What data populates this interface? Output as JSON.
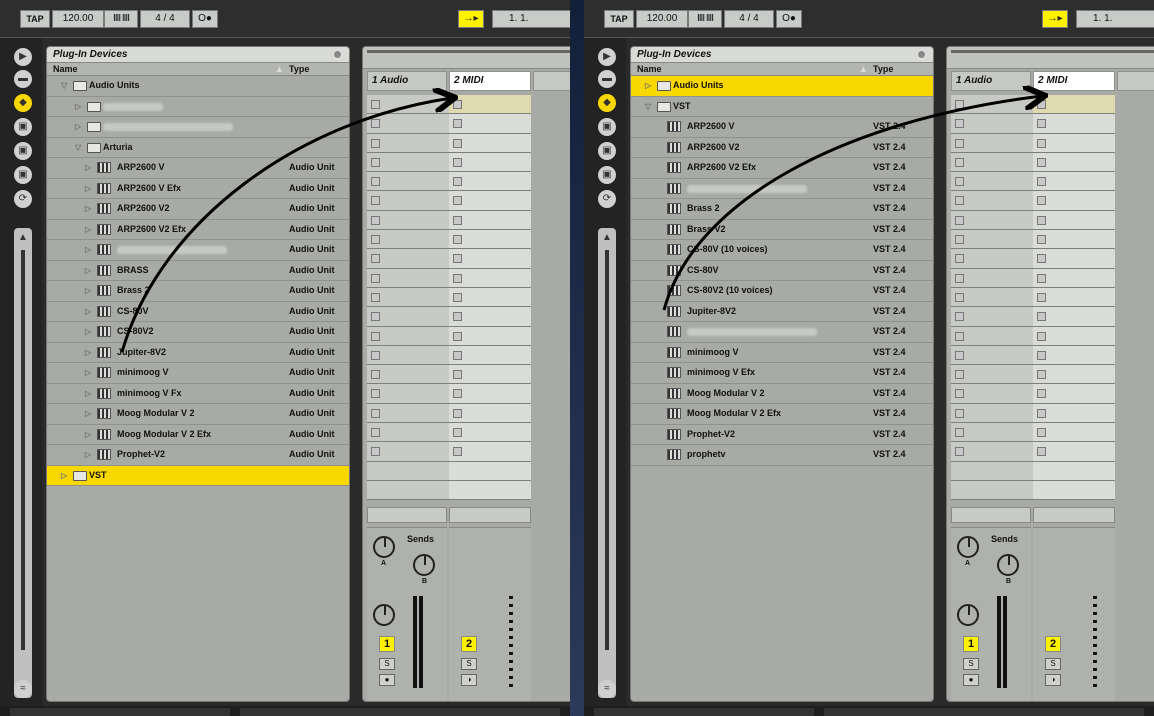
{
  "transport": {
    "tap": "TAP",
    "bpm": "120.00",
    "bars": "IIII IIII",
    "sig": "4 / 4",
    "metro": "O●",
    "follow": "→▸",
    "pos": "1.   1."
  },
  "browser": {
    "title": "Plug-In Devices",
    "col_name": "Name",
    "col_type": "Type"
  },
  "tracks": {
    "t1": "1 Audio",
    "t2": "2 MIDI"
  },
  "mixer": {
    "sends": "Sends",
    "send_a": "A",
    "send_b": "B",
    "num1": "1",
    "num2": "2",
    "solo": "S"
  },
  "left_rows": [
    {
      "label": "Audio Units",
      "type": "",
      "indent": 0,
      "icon": "folder",
      "open": true,
      "sel": false
    },
    {
      "label": "",
      "type": "",
      "indent": 1,
      "icon": "folder",
      "open": false,
      "blur": 60
    },
    {
      "label": "",
      "type": "",
      "indent": 1,
      "icon": "folder",
      "open": false,
      "blur": 130
    },
    {
      "label": "Arturia",
      "type": "",
      "indent": 1,
      "icon": "folder",
      "open": true
    },
    {
      "label": "ARP2600 V",
      "type": "Audio Unit",
      "indent": 2,
      "icon": "plugin"
    },
    {
      "label": "ARP2600 V Efx",
      "type": "Audio Unit",
      "indent": 2,
      "icon": "plugin"
    },
    {
      "label": "ARP2600 V2",
      "type": "Audio Unit",
      "indent": 2,
      "icon": "plugin"
    },
    {
      "label": "ARP2600 V2 Efx",
      "type": "Audio Unit",
      "indent": 2,
      "icon": "plugin"
    },
    {
      "label": "",
      "type": "Audio Unit",
      "indent": 2,
      "icon": "plugin",
      "blur": 110
    },
    {
      "label": "BRASS",
      "type": "Audio Unit",
      "indent": 2,
      "icon": "plugin"
    },
    {
      "label": "Brass 2",
      "type": "Audio Unit",
      "indent": 2,
      "icon": "plugin"
    },
    {
      "label": "CS-80V",
      "type": "Audio Unit",
      "indent": 2,
      "icon": "plugin"
    },
    {
      "label": "CS-80V2",
      "type": "Audio Unit",
      "indent": 2,
      "icon": "plugin"
    },
    {
      "label": "Jupiter-8V2",
      "type": "Audio Unit",
      "indent": 2,
      "icon": "plugin"
    },
    {
      "label": "minimoog V",
      "type": "Audio Unit",
      "indent": 2,
      "icon": "plugin"
    },
    {
      "label": "minimoog V Fx",
      "type": "Audio Unit",
      "indent": 2,
      "icon": "plugin"
    },
    {
      "label": "Moog Modular V 2",
      "type": "Audio Unit",
      "indent": 2,
      "icon": "plugin"
    },
    {
      "label": "Moog Modular V 2 Efx",
      "type": "Audio Unit",
      "indent": 2,
      "icon": "plugin"
    },
    {
      "label": "Prophet-V2",
      "type": "Audio Unit",
      "indent": 2,
      "icon": "plugin"
    },
    {
      "label": "VST",
      "type": "",
      "indent": 0,
      "icon": "folder",
      "open": false,
      "sel": true
    }
  ],
  "right_rows": [
    {
      "label": "Audio Units",
      "type": "",
      "indent": 0,
      "icon": "folder",
      "open": false,
      "sel": true
    },
    {
      "label": "VST",
      "type": "",
      "indent": 0,
      "icon": "folder",
      "open": true
    },
    {
      "label": "ARP2600 V",
      "type": "VST 2.4",
      "indent": 1,
      "icon": "plugin"
    },
    {
      "label": "ARP2600 V2",
      "type": "VST 2.4",
      "indent": 1,
      "icon": "plugin"
    },
    {
      "label": "ARP2600 V2 Efx",
      "type": "VST 2.4",
      "indent": 1,
      "icon": "plugin"
    },
    {
      "label": "",
      "type": "VST 2.4",
      "indent": 1,
      "icon": "plugin",
      "blur": 120
    },
    {
      "label": "Brass 2",
      "type": "VST 2.4",
      "indent": 1,
      "icon": "plugin"
    },
    {
      "label": "Brass V2",
      "type": "VST 2.4",
      "indent": 1,
      "icon": "plugin"
    },
    {
      "label": "CS-80V (10 voices)",
      "type": "VST 2.4",
      "indent": 1,
      "icon": "plugin"
    },
    {
      "label": "CS-80V",
      "type": "VST 2.4",
      "indent": 1,
      "icon": "plugin"
    },
    {
      "label": "CS-80V2 (10 voices)",
      "type": "VST 2.4",
      "indent": 1,
      "icon": "plugin"
    },
    {
      "label": "Jupiter-8V2",
      "type": "VST 2.4",
      "indent": 1,
      "icon": "plugin"
    },
    {
      "label": "",
      "type": "VST 2.4",
      "indent": 1,
      "icon": "plugin",
      "blur": 130
    },
    {
      "label": "minimoog V",
      "type": "VST 2.4",
      "indent": 1,
      "icon": "plugin"
    },
    {
      "label": "minimoog V Efx",
      "type": "VST 2.4",
      "indent": 1,
      "icon": "plugin"
    },
    {
      "label": "Moog Modular V 2",
      "type": "VST 2.4",
      "indent": 1,
      "icon": "plugin"
    },
    {
      "label": "Moog Modular V 2 Efx",
      "type": "VST 2.4",
      "indent": 1,
      "icon": "plugin"
    },
    {
      "label": "Prophet-V2",
      "type": "VST 2.4",
      "indent": 1,
      "icon": "plugin"
    },
    {
      "label": "prophetv",
      "type": "VST 2.4",
      "indent": 1,
      "icon": "plugin"
    }
  ]
}
